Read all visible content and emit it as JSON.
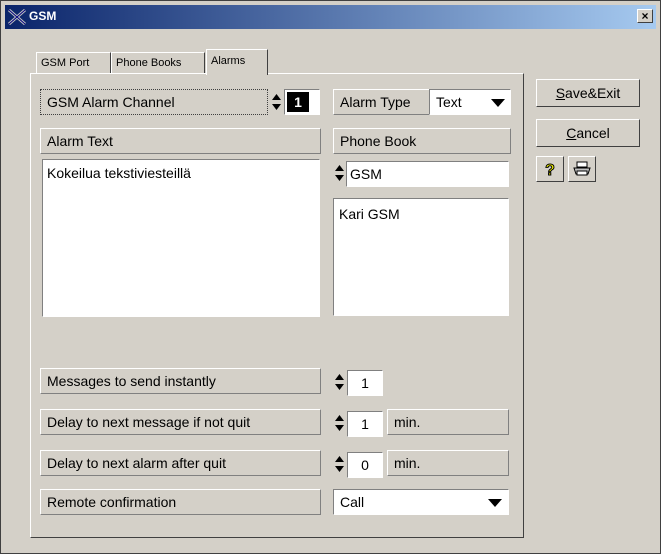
{
  "window": {
    "title": "GSM",
    "close_glyph": "×"
  },
  "tabs": [
    {
      "label": "GSM Port",
      "active": false
    },
    {
      "label": "Phone Books",
      "active": false
    },
    {
      "label": "Alarms",
      "active": true
    }
  ],
  "alarm_channel": {
    "label": "GSM Alarm Channel",
    "value": "1"
  },
  "alarm_type": {
    "label": "Alarm Type",
    "value": "Text"
  },
  "alarm_text": {
    "label": "Alarm Text",
    "value": "Kokeilua tekstiviesteillä"
  },
  "phone_book": {
    "label": "Phone Book",
    "selected": "GSM",
    "entries": [
      "Kari GSM"
    ]
  },
  "messages_instant": {
    "label": "Messages to send instantly",
    "value": "1"
  },
  "delay_next_message": {
    "label": "Delay to next message if not quit",
    "value": "1",
    "unit": "min."
  },
  "delay_next_alarm": {
    "label": "Delay to next alarm after quit",
    "value": "0",
    "unit": "min."
  },
  "remote_confirmation": {
    "label": "Remote confirmation",
    "value": "Call"
  },
  "buttons": {
    "save_exit": "Save&Exit",
    "cancel": "Cancel"
  },
  "icons": {
    "help": "help-icon",
    "print": "print-icon"
  },
  "colors": {
    "titlebar_start": "#0a246a",
    "titlebar_end": "#a6caf0",
    "face": "#d4d0c8",
    "help_yellow": "#ffff00"
  }
}
